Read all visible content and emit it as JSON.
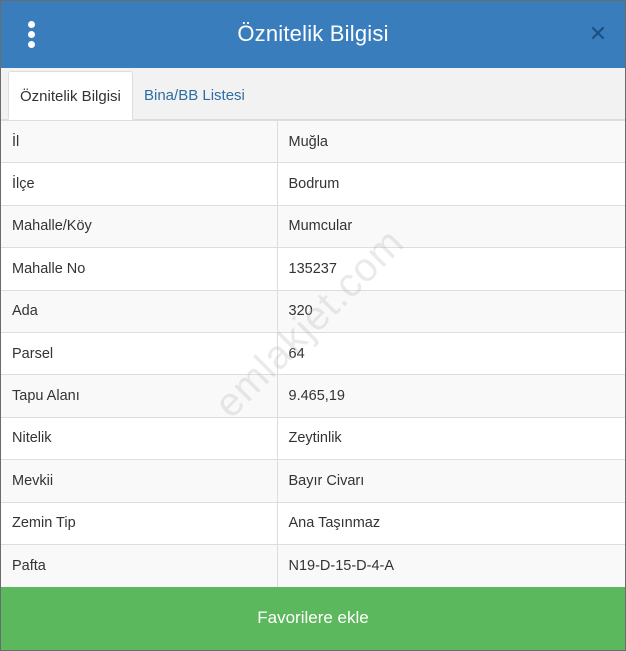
{
  "header": {
    "title": "Öznitelik Bilgisi"
  },
  "icons": {
    "menu": "vertical-dots-icon",
    "close": "close-icon"
  },
  "tabs": [
    {
      "label": "Öznitelik Bilgisi",
      "active": true
    },
    {
      "label": "Bina/BB Listesi",
      "active": false
    }
  ],
  "rows": [
    {
      "key": "İl",
      "value": "Muğla"
    },
    {
      "key": "İlçe",
      "value": "Bodrum"
    },
    {
      "key": "Mahalle/Köy",
      "value": "Mumcular"
    },
    {
      "key": "Mahalle No",
      "value": "135237"
    },
    {
      "key": "Ada",
      "value": "320"
    },
    {
      "key": "Parsel",
      "value": "64"
    },
    {
      "key": "Tapu Alanı",
      "value": "9.465,19"
    },
    {
      "key": "Nitelik",
      "value": "Zeytinlik"
    },
    {
      "key": "Mevkii",
      "value": "Bayır Civarı"
    },
    {
      "key": "Zemin Tip",
      "value": "Ana Taşınmaz"
    },
    {
      "key": "Pafta",
      "value": "N19-D-15-D-4-A"
    }
  ],
  "footer": {
    "favorite_label": "Favorilere ekle"
  },
  "watermark": "emlakjet.com",
  "colors": {
    "header": "#3a7dbd",
    "favorite": "#5cb85c",
    "tab_link": "#2e6da4"
  }
}
